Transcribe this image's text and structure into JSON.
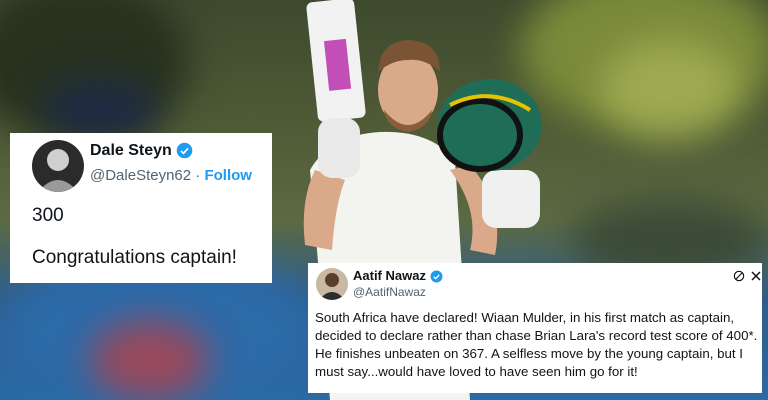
{
  "tweet_steyn": {
    "name": "Dale Steyn",
    "handle": "@DaleSteyn62",
    "separator": "·",
    "follow": "Follow",
    "line1": "300",
    "line2": "Congratulations captain!"
  },
  "tweet_nawaz": {
    "name": "Aatif Nawaz",
    "handle": "@AatifNawaz",
    "text": "South Africa have declared! Wiaan Mulder, in his first match as captain, decided to declare rather than chase Brian Lara's record test score of 400*. He finishes unbeaten on 367. A selfless move by the young captain, but I must say...would have loved to have seen him go for it!"
  },
  "colors": {
    "verified": "#1d9bf0",
    "follow": "#1d9bf0",
    "text": "#0f1419",
    "handle": "#536471"
  }
}
